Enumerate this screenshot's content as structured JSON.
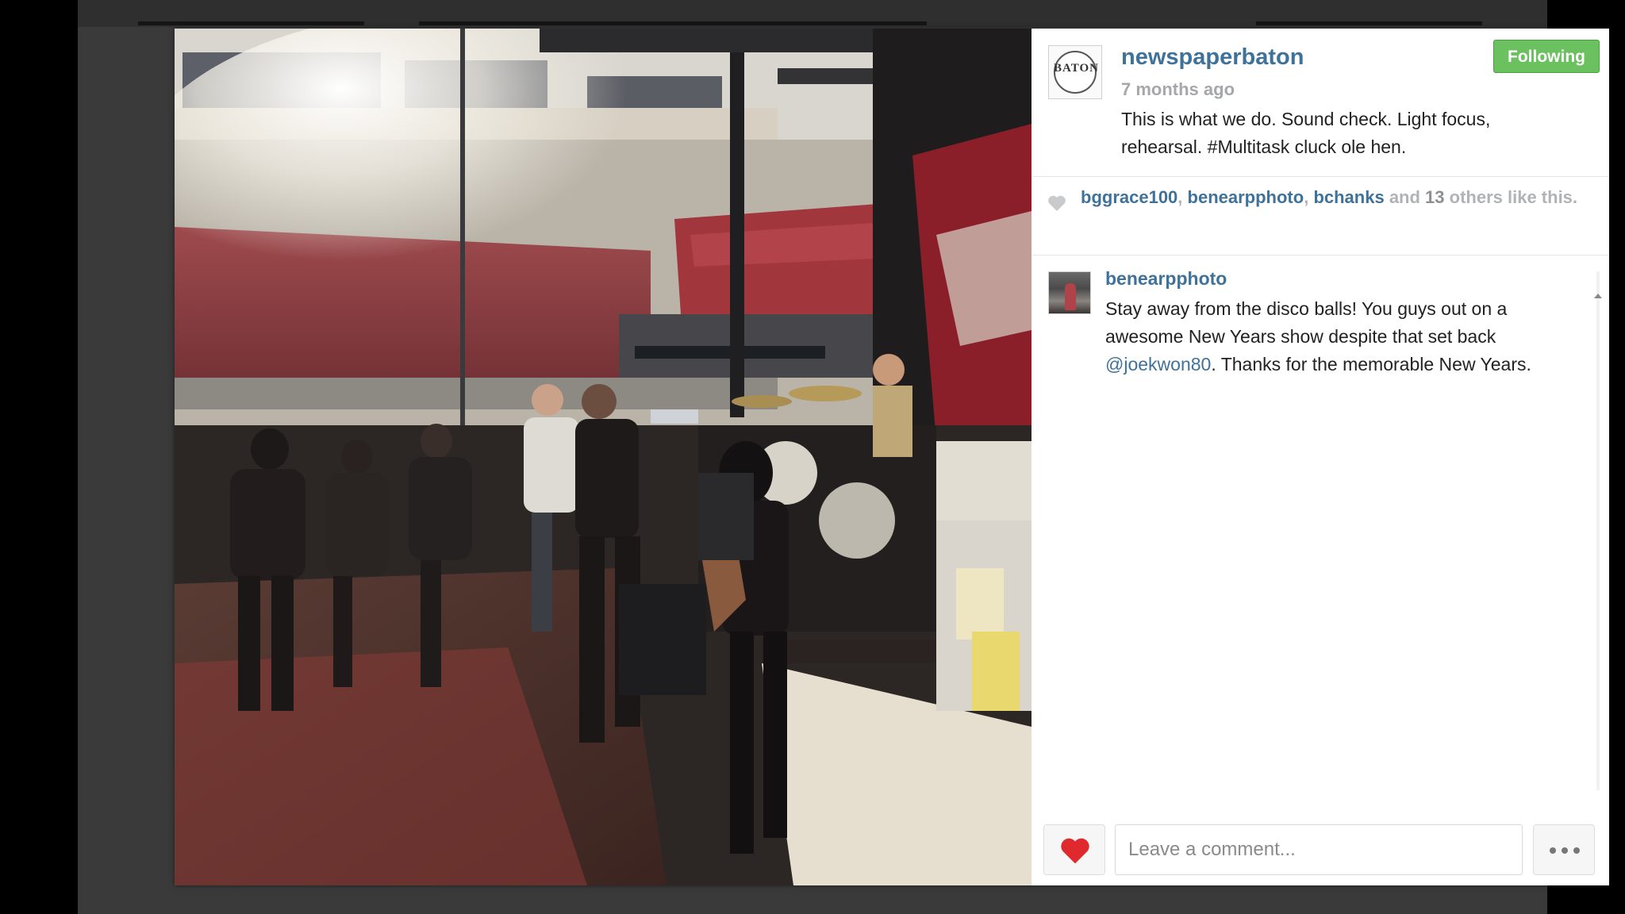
{
  "post": {
    "username": "newspaperbaton",
    "avatar_text": "BATON",
    "time_ago": "7 months ago",
    "caption": "This is what we do. Sound check. Light focus, rehearsal. #Multitask cluck ole hen.",
    "follow_label": "Following"
  },
  "likes": {
    "likers": [
      "bggrace100",
      "benearpphoto",
      "bchanks"
    ],
    "sep1": ", ",
    "sep2": ", ",
    "and_word": " and ",
    "others_count": "13",
    "suffix": " others like this."
  },
  "comments": [
    {
      "user": "benearpphoto",
      "text_before": "Stay away from the disco balls! You guys out on a awesome New Years show despite that set back ",
      "mention": "@joekwon80",
      "text_after": ". Thanks for the memorable New Years."
    }
  ],
  "composer": {
    "placeholder": "Leave a comment...",
    "like_icon": "heart-icon",
    "more_icon": "more-dots-icon"
  },
  "colors": {
    "link": "#3f729b",
    "follow_bg": "#6bc05f",
    "heart": "#e0292e"
  }
}
